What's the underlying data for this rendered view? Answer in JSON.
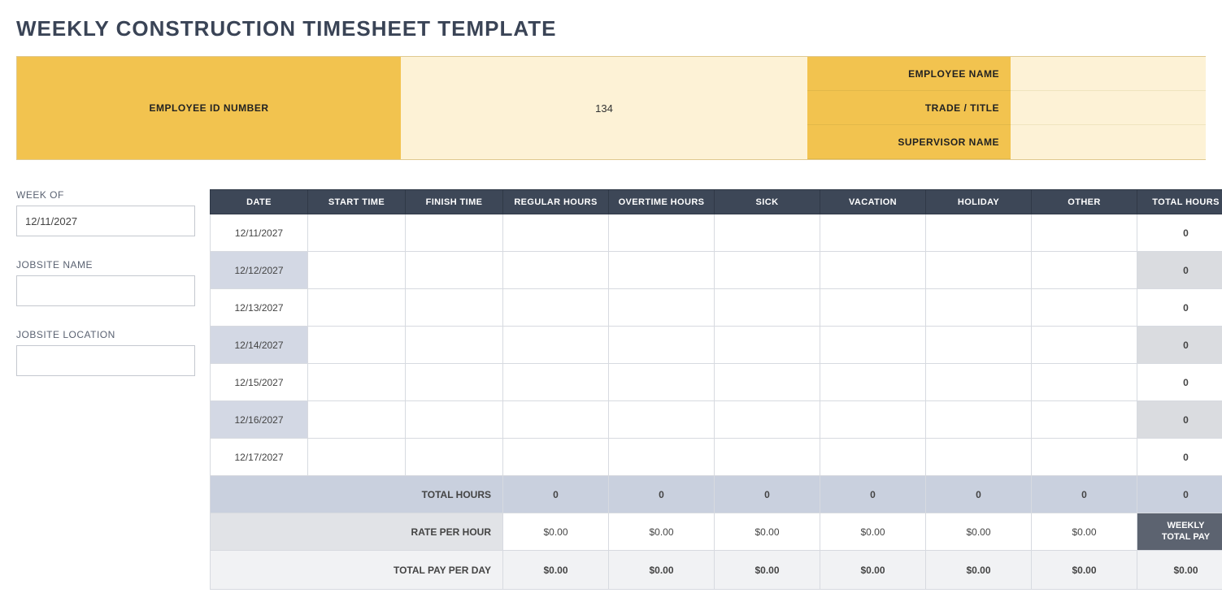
{
  "title": "WEEKLY CONSTRUCTION TIMESHEET TEMPLATE",
  "header": {
    "employee_name_label": "EMPLOYEE NAME",
    "employee_name_value": "",
    "trade_title_label": "TRADE / TITLE",
    "trade_title_value": "",
    "supervisor_name_label": "SUPERVISOR NAME",
    "supervisor_name_value": "",
    "employee_id_label": "EMPLOYEE ID NUMBER",
    "employee_id_value": "134"
  },
  "sidebar": {
    "week_of_label": "WEEK OF",
    "week_of_value": "12/11/2027",
    "jobsite_name_label": "JOBSITE NAME",
    "jobsite_name_value": "",
    "jobsite_location_label": "JOBSITE LOCATION",
    "jobsite_location_value": ""
  },
  "columns": {
    "date": "DATE",
    "start": "START TIME",
    "finish": "FINISH TIME",
    "regular": "REGULAR HOURS",
    "overtime": "OVERTIME HOURS",
    "sick": "SICK",
    "vacation": "VACATION",
    "holiday": "HOLIDAY",
    "other": "OTHER",
    "total": "TOTAL HOURS"
  },
  "rows": [
    {
      "date": "12/11/2027",
      "start": "",
      "finish": "",
      "regular": "",
      "overtime": "",
      "sick": "",
      "vacation": "",
      "holiday": "",
      "other": "",
      "total": "0"
    },
    {
      "date": "12/12/2027",
      "start": "",
      "finish": "",
      "regular": "",
      "overtime": "",
      "sick": "",
      "vacation": "",
      "holiday": "",
      "other": "",
      "total": "0"
    },
    {
      "date": "12/13/2027",
      "start": "",
      "finish": "",
      "regular": "",
      "overtime": "",
      "sick": "",
      "vacation": "",
      "holiday": "",
      "other": "",
      "total": "0"
    },
    {
      "date": "12/14/2027",
      "start": "",
      "finish": "",
      "regular": "",
      "overtime": "",
      "sick": "",
      "vacation": "",
      "holiday": "",
      "other": "",
      "total": "0"
    },
    {
      "date": "12/15/2027",
      "start": "",
      "finish": "",
      "regular": "",
      "overtime": "",
      "sick": "",
      "vacation": "",
      "holiday": "",
      "other": "",
      "total": "0"
    },
    {
      "date": "12/16/2027",
      "start": "",
      "finish": "",
      "regular": "",
      "overtime": "",
      "sick": "",
      "vacation": "",
      "holiday": "",
      "other": "",
      "total": "0"
    },
    {
      "date": "12/17/2027",
      "start": "",
      "finish": "",
      "regular": "",
      "overtime": "",
      "sick": "",
      "vacation": "",
      "holiday": "",
      "other": "",
      "total": "0"
    }
  ],
  "totals": {
    "label": "TOTAL HOURS",
    "regular": "0",
    "overtime": "0",
    "sick": "0",
    "vacation": "0",
    "holiday": "0",
    "other": "0",
    "total": "0"
  },
  "rate": {
    "label": "RATE PER HOUR",
    "regular": "$0.00",
    "overtime": "$0.00",
    "sick": "$0.00",
    "vacation": "$0.00",
    "holiday": "$0.00",
    "other": "$0.00",
    "weekly_label": "WEEKLY\nTOTAL PAY"
  },
  "pay": {
    "label": "TOTAL PAY PER DAY",
    "regular": "$0.00",
    "overtime": "$0.00",
    "sick": "$0.00",
    "vacation": "$0.00",
    "holiday": "$0.00",
    "other": "$0.00",
    "total": "$0.00"
  },
  "chart_data": {
    "type": "table",
    "title": "Weekly Construction Timesheet",
    "columns": [
      "DATE",
      "START TIME",
      "FINISH TIME",
      "REGULAR HOURS",
      "OVERTIME HOURS",
      "SICK",
      "VACATION",
      "HOLIDAY",
      "OTHER",
      "TOTAL HOURS"
    ],
    "data": [
      [
        "12/11/2027",
        "",
        "",
        "",
        "",
        "",
        "",
        "",
        "",
        "0"
      ],
      [
        "12/12/2027",
        "",
        "",
        "",
        "",
        "",
        "",
        "",
        "",
        "0"
      ],
      [
        "12/13/2027",
        "",
        "",
        "",
        "",
        "",
        "",
        "",
        "",
        "0"
      ],
      [
        "12/14/2027",
        "",
        "",
        "",
        "",
        "",
        "",
        "",
        "",
        "0"
      ],
      [
        "12/15/2027",
        "",
        "",
        "",
        "",
        "",
        "",
        "",
        "",
        "0"
      ],
      [
        "12/16/2027",
        "",
        "",
        "",
        "",
        "",
        "",
        "",
        "",
        "0"
      ],
      [
        "12/17/2027",
        "",
        "",
        "",
        "",
        "",
        "",
        "",
        "",
        "0"
      ]
    ],
    "totals_row": [
      "TOTAL HOURS",
      "",
      "",
      "0",
      "0",
      "0",
      "0",
      "0",
      "0",
      "0"
    ],
    "rate_row": [
      "RATE PER HOUR",
      "",
      "",
      "$0.00",
      "$0.00",
      "$0.00",
      "$0.00",
      "$0.00",
      "$0.00",
      "WEEKLY TOTAL PAY"
    ],
    "pay_row": [
      "TOTAL PAY PER DAY",
      "",
      "",
      "$0.00",
      "$0.00",
      "$0.00",
      "$0.00",
      "$0.00",
      "$0.00",
      "$0.00"
    ]
  }
}
